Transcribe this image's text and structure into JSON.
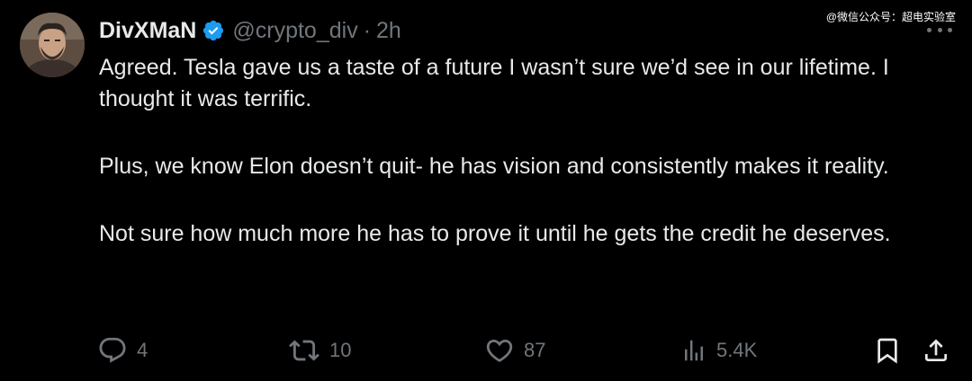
{
  "tweet": {
    "author": {
      "display_name": "DivXMaN",
      "handle": "@crypto_div",
      "separator": "·",
      "time": "2h",
      "verified": true,
      "avatar_icon": "avatar-photo"
    },
    "watermark": "@微信公众号：超电实验室",
    "paragraphs": [
      "Agreed. Tesla gave us a taste of a future I wasn’t sure we’d see in our lifetime. I thought it was terrific.",
      "Plus, we know Elon doesn’t quit- he has vision and consistently makes it reality.",
      "Not sure how much more he has to prove it until he gets the credit he deserves."
    ],
    "actions": {
      "reply": {
        "icon": "reply-icon",
        "count": "4"
      },
      "repost": {
        "icon": "repost-icon",
        "count": "10"
      },
      "like": {
        "icon": "like-icon",
        "count": "87"
      },
      "views": {
        "icon": "views-icon",
        "count": "5.4K"
      },
      "bookmark": {
        "icon": "bookmark-icon"
      },
      "share": {
        "icon": "share-icon"
      }
    }
  },
  "colors": {
    "background": "#000000",
    "text": "#e7e9ea",
    "muted": "#71767b",
    "verified": "#1d9bf0"
  }
}
